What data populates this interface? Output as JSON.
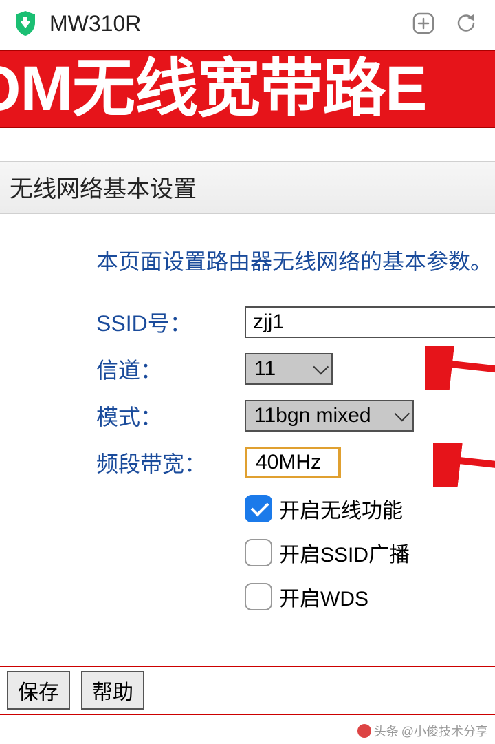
{
  "browser": {
    "title": "MW310R"
  },
  "banner": {
    "text": "ƆM无线宽带路E"
  },
  "section": {
    "title": "无线网络基本设置",
    "description": "本页面设置路由器无线网络的基本参数。"
  },
  "fields": {
    "ssid": {
      "label": "SSID号：",
      "value": "zjj1"
    },
    "channel": {
      "label": "信道：",
      "value": "11"
    },
    "mode": {
      "label": "模式：",
      "value": "11bgn mixed"
    },
    "bandwidth": {
      "label": "频段带宽：",
      "value": "40MHz"
    }
  },
  "checkboxes": {
    "wifi_enable": {
      "label": "开启无线功能",
      "checked": true
    },
    "ssid_broadcast": {
      "label": "开启SSID广播",
      "checked": false
    },
    "wds": {
      "label": "开启WDS",
      "checked": false
    }
  },
  "buttons": {
    "save": "保存",
    "help": "帮助"
  },
  "watermark": {
    "prefix": "头条",
    "text": "@小俊技术分享"
  }
}
